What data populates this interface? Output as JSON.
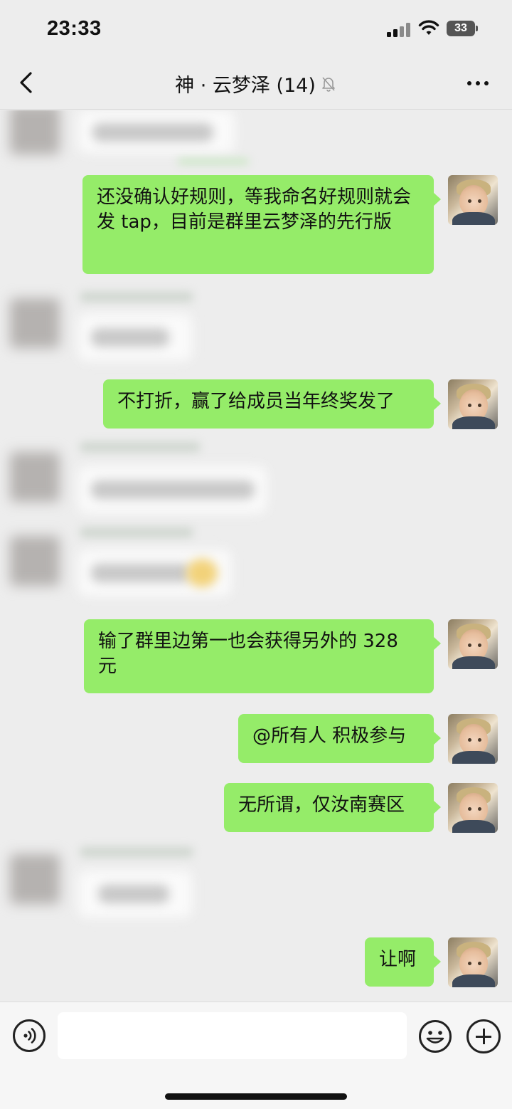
{
  "status_bar": {
    "time": "23:33",
    "battery": "33",
    "icons": [
      "signal-icon",
      "wifi-icon",
      "battery-icon"
    ]
  },
  "nav": {
    "title": "神 · 云梦泽 (14)",
    "back_icon": "chevron-left-icon",
    "mute_icon": "bell-slash-icon",
    "more_icon": "more-dots-icon"
  },
  "messages": [
    {
      "sender": "other",
      "text": ""
    },
    {
      "sender": "me",
      "text": "还没确认好规则，等我命名好规则就会发 tap，目前是群里云梦泽的先行版"
    },
    {
      "sender": "other",
      "text": ""
    },
    {
      "sender": "me",
      "text": "不打折，赢了给成员当年终奖发了"
    },
    {
      "sender": "other",
      "text": ""
    },
    {
      "sender": "other",
      "text": ""
    },
    {
      "sender": "me",
      "text": "输了群里边第一也会获得另外的 328 元"
    },
    {
      "sender": "me",
      "text": "@所有人 积极参与"
    },
    {
      "sender": "me",
      "text": "无所谓，仅汝南赛区"
    },
    {
      "sender": "other",
      "text": ""
    },
    {
      "sender": "me",
      "text": "让啊"
    }
  ],
  "input_bar": {
    "voice_icon": "voice-icon",
    "placeholder": "",
    "emoji_icon": "emoji-icon",
    "plus_icon": "plus-icon"
  },
  "colors": {
    "background": "#ededed",
    "my_bubble": "#95ec69",
    "input_bar": "#f6f6f6"
  }
}
